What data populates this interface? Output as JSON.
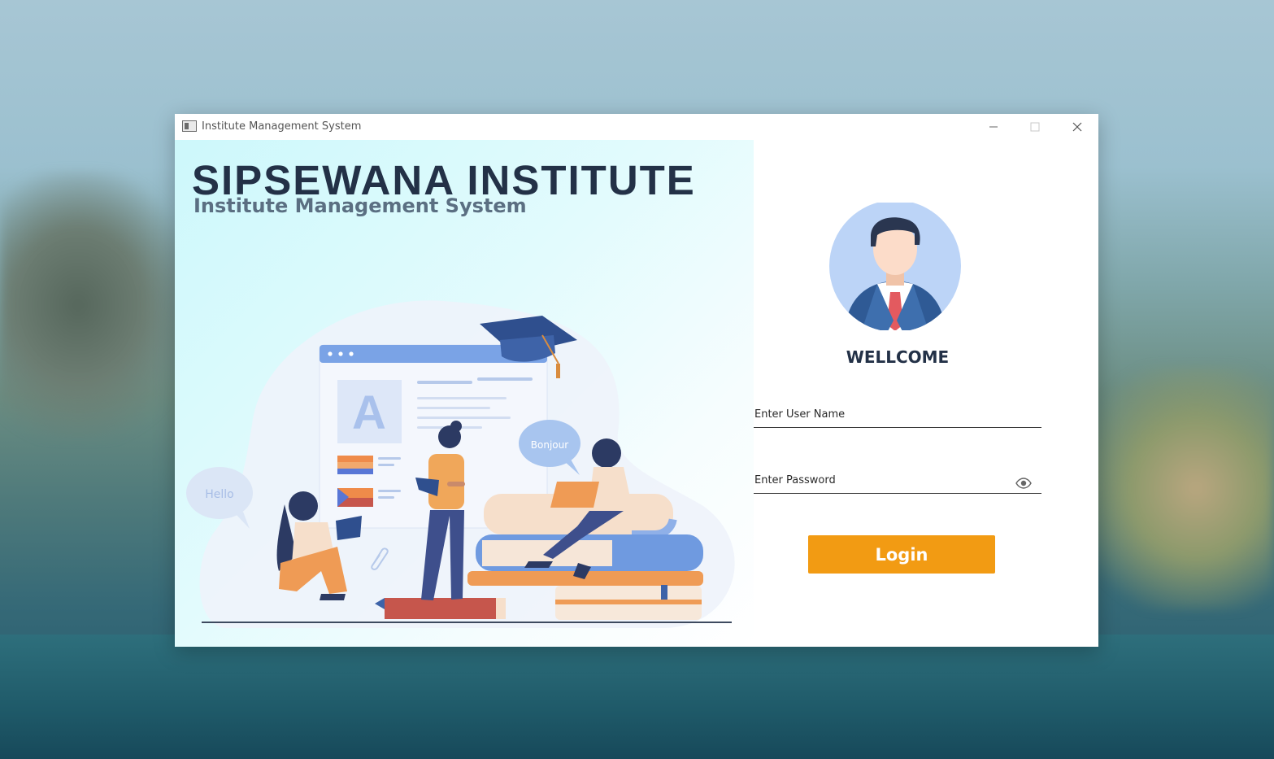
{
  "window": {
    "title": "Institute Management System"
  },
  "brand": {
    "title": "SIPSEWANA INSTITUTE",
    "subtitle": "Institute Management System"
  },
  "illustration": {
    "bubble_hello": "Hello",
    "bubble_bonjour": "Bonjour",
    "letter": "A"
  },
  "login": {
    "welcome": "WELLCOME",
    "username_placeholder": "Enter User Name",
    "password_placeholder": "Enter Password",
    "button_label": "Login"
  },
  "colors": {
    "accent": "#f29b13",
    "heading": "#233147",
    "subheading": "#5b6f82"
  },
  "icons": {
    "titlebar": [
      "app-icon",
      "minimize-icon",
      "maximize-icon",
      "close-icon"
    ],
    "password": "eye-icon"
  }
}
